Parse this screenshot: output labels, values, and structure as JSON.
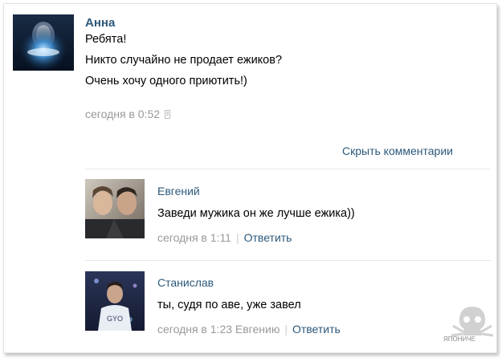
{
  "post": {
    "author": "Анна",
    "lines": [
      "Ребята!",
      "Никто случайно не продает ежиков?",
      "Очень хочу одного приютить!)"
    ],
    "timestamp": "сегодня в 0:52",
    "device_icon": "phone-icon"
  },
  "hide_comments_label": "Скрыть комментарии",
  "comments": [
    {
      "author": "Евгений",
      "text": "Заведи мужика он же лучше ежика))",
      "timestamp": "сегодня в 1:11",
      "reply_label": "Ответить"
    },
    {
      "author": "Станислав",
      "text": "ты, судя по аве, уже завел",
      "timestamp": "сегодня в 1:23",
      "reply_to": "Евгению",
      "reply_label": "Ответить"
    }
  ],
  "watermark": "ЯПОНИЧЕ"
}
